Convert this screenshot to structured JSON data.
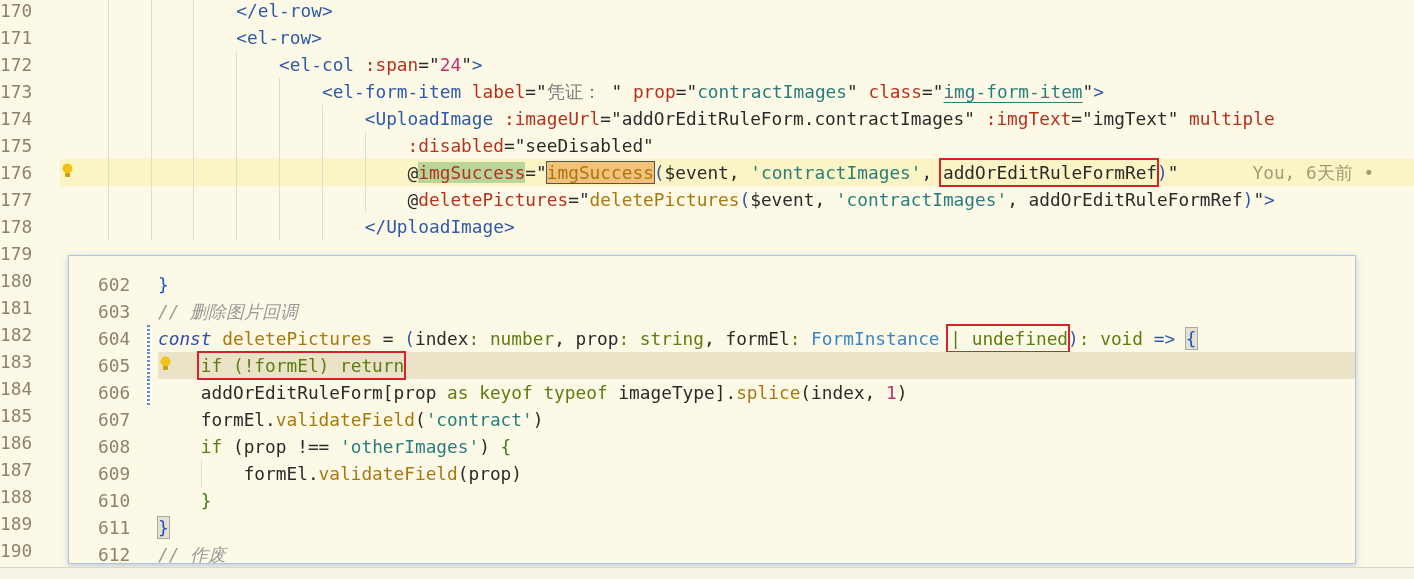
{
  "editor": {
    "lines": [
      {
        "number": "170",
        "tokens": [
          {
            "text": "                </el-row>",
            "kind": "tag"
          }
        ]
      },
      {
        "number": "171",
        "tokens": [
          {
            "text": "                <el-row>",
            "kind": "tag"
          }
        ]
      },
      {
        "number": "172",
        "tokens": [
          {
            "text": "                    <el-col",
            "kind": "tag"
          },
          {
            "text": " :span",
            "kind": "attr"
          },
          {
            "text": "=\"",
            "kind": "plain"
          },
          {
            "text": "24",
            "kind": "number"
          },
          {
            "text": "\"",
            "kind": "plain"
          },
          {
            "text": ">",
            "kind": "tag"
          }
        ]
      },
      {
        "number": "173",
        "tokens": [
          {
            "text": "                        <el-form-item",
            "kind": "tag"
          },
          {
            "text": " label",
            "kind": "attr"
          },
          {
            "text": "=\"",
            "kind": "plain"
          },
          {
            "text": "凭证： ",
            "kind": "label"
          },
          {
            "text": "\"",
            "kind": "plain"
          },
          {
            "text": " prop",
            "kind": "attr"
          },
          {
            "text": "=\"",
            "kind": "plain"
          },
          {
            "text": "contractImages",
            "kind": "value"
          },
          {
            "text": "\"",
            "kind": "plain"
          },
          {
            "text": " class",
            "kind": "attr"
          },
          {
            "text": "=\"",
            "kind": "plain"
          },
          {
            "text": "img-form-item",
            "kind": "link"
          },
          {
            "text": "\"",
            "kind": "plain"
          },
          {
            "text": ">",
            "kind": "tag"
          }
        ]
      },
      {
        "number": "174",
        "tokens": [
          {
            "text": "                            <UploadImage",
            "kind": "tag"
          },
          {
            "text": " :imageUrl",
            "kind": "attr"
          },
          {
            "text": "=\"addOrEditRuleForm.contractImages\"",
            "kind": "plain"
          },
          {
            "text": " :imgText",
            "kind": "attr"
          },
          {
            "text": "=\"imgText\"",
            "kind": "plain"
          },
          {
            "text": " multiple",
            "kind": "attr"
          }
        ]
      },
      {
        "number": "175",
        "tokens": [
          {
            "text": "                                :disabled",
            "kind": "attr"
          },
          {
            "text": "=\"seeDisabled\"",
            "kind": "plain"
          }
        ]
      },
      {
        "number": "176",
        "current": true,
        "bulb": true,
        "blame": "You, 6天前 •",
        "tokens": [
          {
            "text": "                                @",
            "kind": "plain"
          },
          {
            "text": "imgSuccess",
            "kind": "attr",
            "highlighted": true
          },
          {
            "text": "=\"",
            "kind": "plain"
          },
          {
            "text": "imgSuccess",
            "kind": "fn",
            "highlighted": true
          },
          {
            "text": "(",
            "kind": "tag"
          },
          {
            "text": "$event, ",
            "kind": "plain"
          },
          {
            "text": "'contractImages'",
            "kind": "string"
          },
          {
            "text": ", ",
            "kind": "plain"
          },
          {
            "text": "addOrEditRuleFormRef",
            "kind": "plain",
            "box": true
          },
          {
            "text": ")",
            "kind": "tag"
          },
          {
            "text": "\"",
            "kind": "plain"
          }
        ]
      },
      {
        "number": "177",
        "tokens": [
          {
            "text": "                                @",
            "kind": "plain"
          },
          {
            "text": "deletePictures",
            "kind": "attr"
          },
          {
            "text": "=\"",
            "kind": "plain"
          },
          {
            "text": "deletePictures",
            "kind": "fn"
          },
          {
            "text": "(",
            "kind": "tag"
          },
          {
            "text": "$event, ",
            "kind": "plain"
          },
          {
            "text": "'contractImages'",
            "kind": "string"
          },
          {
            "text": ", addOrEditRuleFormRef",
            "kind": "plain"
          },
          {
            "text": ")",
            "kind": "tag"
          },
          {
            "text": "\"",
            "kind": "plain"
          },
          {
            "text": ">",
            "kind": "tag"
          }
        ]
      },
      {
        "number": "178",
        "tokens": [
          {
            "text": "                            </UploadImage>",
            "kind": "tag"
          }
        ]
      },
      {
        "number": "179"
      },
      {
        "number": "180"
      },
      {
        "number": "181"
      },
      {
        "number": "182"
      },
      {
        "number": "183"
      },
      {
        "number": "184"
      },
      {
        "number": "185"
      },
      {
        "number": "186"
      },
      {
        "number": "187"
      },
      {
        "number": "188"
      },
      {
        "number": "189"
      },
      {
        "number": "190"
      }
    ]
  },
  "peek": {
    "lines": [
      {
        "number": "602",
        "tokens": [
          {
            "text": "}",
            "kind": "brace2"
          }
        ]
      },
      {
        "number": "603",
        "tokens": [
          {
            "text": "// 删除图片回调",
            "kind": "comment"
          }
        ]
      },
      {
        "number": "604",
        "changed": true,
        "tokens": [
          {
            "text": "const ",
            "kind": "storage"
          },
          {
            "text": "deletePictures",
            "kind": "fn"
          },
          {
            "text": " = ",
            "kind": "plain"
          },
          {
            "text": "(",
            "kind": "tag"
          },
          {
            "text": "index",
            "kind": "plain"
          },
          {
            "text": ": ",
            "kind": "keyword"
          },
          {
            "text": "number",
            "kind": "keyword"
          },
          {
            "text": ", prop",
            "kind": "plain"
          },
          {
            "text": ": ",
            "kind": "keyword"
          },
          {
            "text": "string",
            "kind": "keyword"
          },
          {
            "text": ", formEl",
            "kind": "plain"
          },
          {
            "text": ": ",
            "kind": "keyword"
          },
          {
            "text": "FormInstance",
            "kind": "type"
          },
          {
            "text": " | undefined",
            "kind": "keyword",
            "box": true
          },
          {
            "text": ")",
            "kind": "tag"
          },
          {
            "text": ": ",
            "kind": "keyword"
          },
          {
            "text": "void",
            "kind": "keyword"
          },
          {
            "text": " => ",
            "kind": "tag"
          },
          {
            "text": "{",
            "kind": "brace2",
            "highlighted": true
          }
        ]
      },
      {
        "number": "605",
        "current": true,
        "bulb": true,
        "changed": true,
        "cursor": true,
        "tokens": [
          {
            "text": "    if (!formEl) return",
            "kind": "keyword",
            "box": true
          }
        ]
      },
      {
        "number": "606",
        "changed": true,
        "tokens": [
          {
            "text": "    addOrEditRuleForm[prop ",
            "kind": "plain"
          },
          {
            "text": "as keyof typeof",
            "kind": "keyword"
          },
          {
            "text": " imageType].",
            "kind": "plain"
          },
          {
            "text": "splice",
            "kind": "fn"
          },
          {
            "text": "(index, ",
            "kind": "plain"
          },
          {
            "text": "1",
            "kind": "number"
          },
          {
            "text": ")",
            "kind": "plain"
          }
        ]
      },
      {
        "number": "607",
        "tokens": [
          {
            "text": "    formEl.",
            "kind": "plain"
          },
          {
            "text": "validateField",
            "kind": "fn"
          },
          {
            "text": "(",
            "kind": "plain"
          },
          {
            "text": "'contract'",
            "kind": "string"
          },
          {
            "text": ")",
            "kind": "plain"
          }
        ]
      },
      {
        "number": "608",
        "tokens": [
          {
            "text": "    if",
            "kind": "keyword"
          },
          {
            "text": " (prop !== ",
            "kind": "plain"
          },
          {
            "text": "'otherImages'",
            "kind": "string"
          },
          {
            "text": ") ",
            "kind": "plain"
          },
          {
            "text": "{",
            "kind": "brace"
          }
        ]
      },
      {
        "number": "609",
        "tokens": [
          {
            "text": "        formEl.",
            "kind": "plain"
          },
          {
            "text": "validateField",
            "kind": "fn"
          },
          {
            "text": "(prop)",
            "kind": "plain"
          }
        ]
      },
      {
        "number": "610",
        "tokens": [
          {
            "text": "    }",
            "kind": "brace"
          }
        ]
      },
      {
        "number": "611",
        "tokens": [
          {
            "text": "}",
            "kind": "brace2",
            "highlighted": true
          }
        ]
      },
      {
        "number": "612",
        "tokens": [
          {
            "text": "// 作废",
            "kind": "comment"
          }
        ]
      }
    ]
  }
}
